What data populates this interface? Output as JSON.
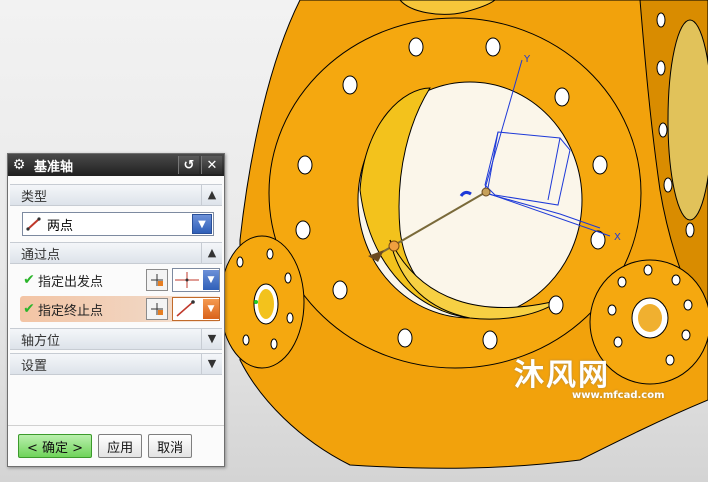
{
  "dialog": {
    "title": "基准轴",
    "sections": {
      "type": "类型",
      "through_points": "通过点",
      "axis_orientation": "轴方位",
      "settings": "设置"
    },
    "type_value": "两点",
    "rows": {
      "start_point": "指定出发点",
      "end_point": "指定终止点"
    },
    "buttons": {
      "ok": "< 确定 >",
      "apply": "应用",
      "cancel": "取消"
    }
  },
  "viewport": {
    "axis_labels": {
      "y": "Y",
      "x": "X"
    },
    "watermark": {
      "text": "沐风网",
      "url": "www.mfcad.com"
    }
  },
  "colors": {
    "part_orange": "#f2a20c",
    "part_shadow": "#c07a00",
    "title_bar": "#2b2b2b",
    "ok_green": "#6fd35a",
    "triad_blue": "#1e3ad8"
  }
}
